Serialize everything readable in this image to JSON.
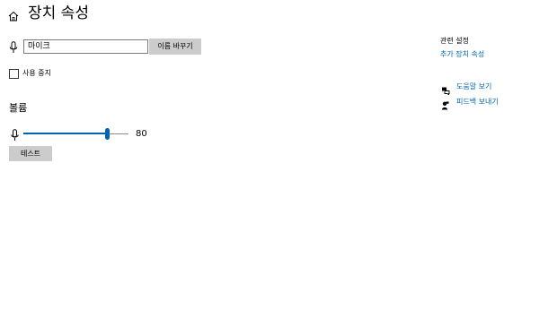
{
  "header": {
    "home_icon": "home-icon",
    "title": "장치 속성"
  },
  "device": {
    "mic_icon": "microphone-icon",
    "name_value": "마이크",
    "rename_label": "이름 바꾸기"
  },
  "disable": {
    "checked": false,
    "label": "사용 중지"
  },
  "volume": {
    "heading": "볼륨",
    "icon": "microphone-icon",
    "value": 80,
    "value_text": "80",
    "min": 0,
    "max": 100
  },
  "test": {
    "label": "테스트"
  },
  "related": {
    "heading": "관련 설정",
    "link_label": "추가 장치 속성"
  },
  "support": {
    "help_label": "도움말 보기",
    "help_icon": "help-chat-icon",
    "feedback_label": "피드백 보내기",
    "feedback_icon": "feedback-icon"
  },
  "colors": {
    "accent": "#0063b1",
    "link": "#0066b4",
    "button_bg": "#cccccc"
  }
}
